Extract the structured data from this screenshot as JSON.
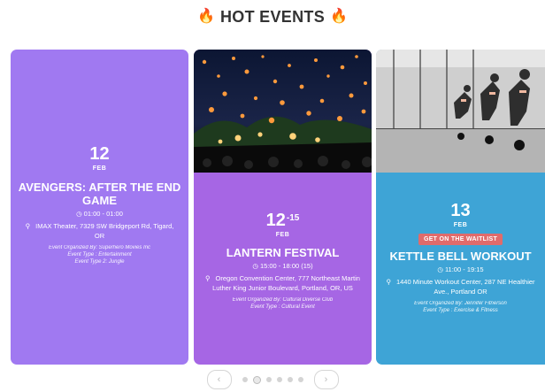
{
  "header": {
    "title": "HOT EVENTS",
    "icon": "fire-icon"
  },
  "events": [
    {
      "day": "12",
      "day_end": "",
      "month": "FEB",
      "title": "AVENGERS: AFTER THE END GAME",
      "time": "01:00 - 01:00",
      "location": "IMAX Theater, 7329 SW Bridgeport Rd, Tigard, OR",
      "organized_by": "Event Organized By: Superhero Movies Inc",
      "event_type": "Event Type : Entertainment",
      "event_type_2": "Event Type 2: Jungle",
      "badge": "",
      "color": "#a079f1"
    },
    {
      "day": "12",
      "day_end": "-15",
      "month": "FEB",
      "title": "LANTERN FESTIVAL",
      "time": "15:00 - 18:00 (15)",
      "location": "Oregon Convention Center, 777 Northeast Martin Luther King Junior Boulevard, Portland, OR, US",
      "organized_by": "Event Organized By: Cultural Diverse Club",
      "event_type": "Event Type : Cultural Event",
      "event_type_2": "",
      "badge": "",
      "color": "#a666e4"
    },
    {
      "day": "13",
      "day_end": "",
      "month": "FEB",
      "title": "KETTLE BELL WORKOUT",
      "time": "11:00 - 19:15",
      "location": "1440 Minute Workout Center, 287 NE Healthier Ave., Portland OR",
      "organized_by": "Event Organized By: Jennifer Fitnerson",
      "event_type": "Event Type : Exercise & Fitness",
      "event_type_2": "",
      "badge": "GET ON THE WAITLIST",
      "color": "#3ea4d6"
    }
  ],
  "pager": {
    "prev_icon": "chevron-left-icon",
    "next_icon": "chevron-right-icon",
    "prev_glyph": "‹",
    "next_glyph": "›",
    "dot_count": 6,
    "active_dot": 1
  }
}
